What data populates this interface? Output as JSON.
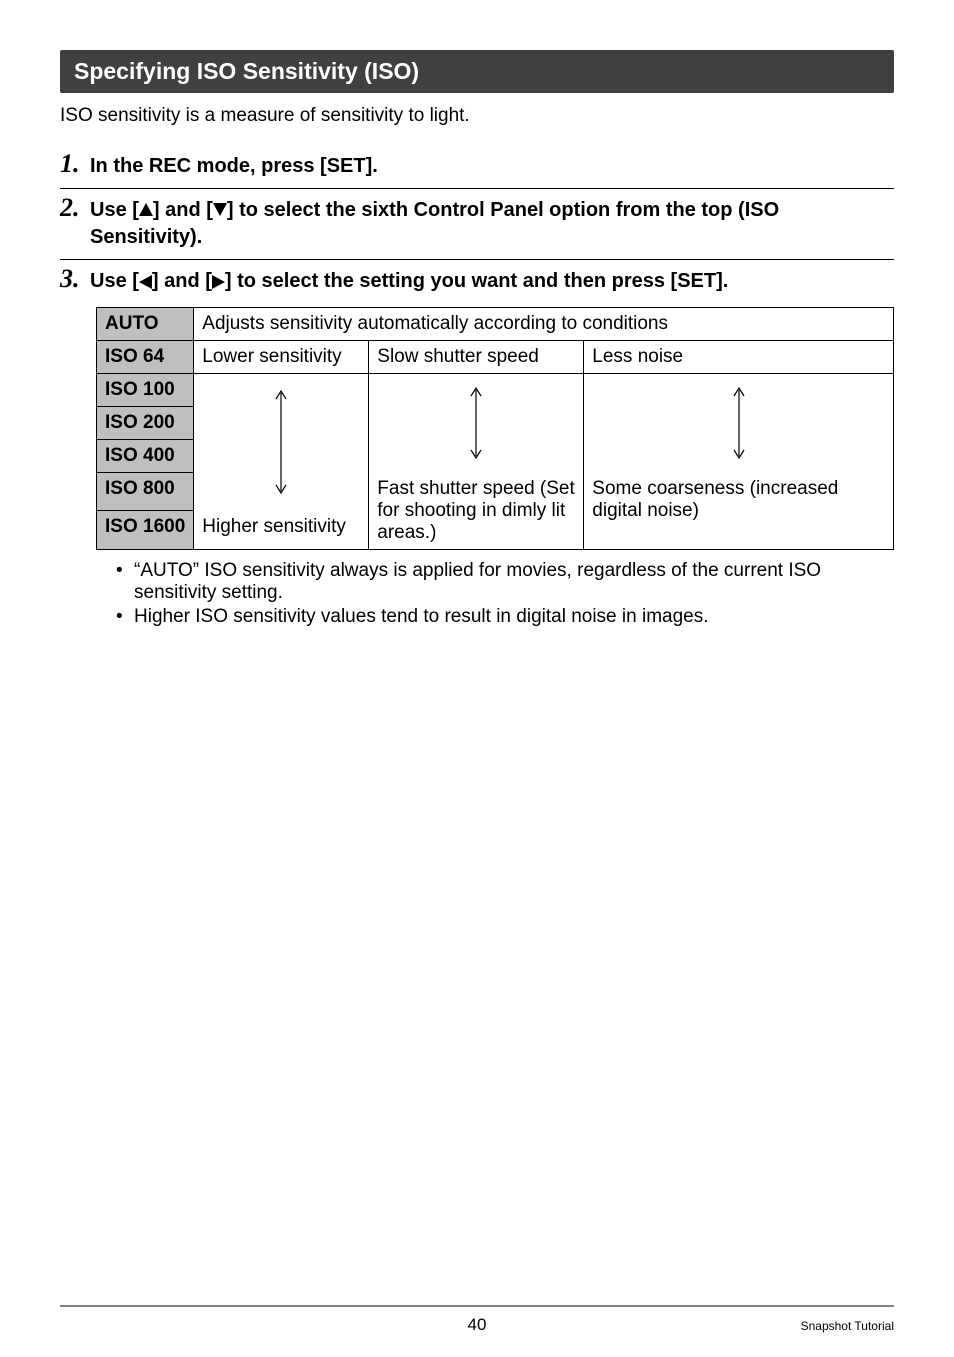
{
  "section_title": "Specifying ISO Sensitivity (ISO)",
  "intro": "ISO sensitivity is a measure of sensitivity to light.",
  "steps": [
    {
      "num": "1.",
      "before": "In the REC mode, press [SET]."
    },
    {
      "num": "2.",
      "before": "Use [",
      "mid": "] and [",
      "after": "] to select the sixth Control Panel option from the top (ISO Sensitivity)."
    },
    {
      "num": "3.",
      "before": "Use [",
      "mid": "] and [",
      "after": "] to select the setting you want and then press [SET]."
    }
  ],
  "table": {
    "rows": [
      "AUTO",
      "ISO 64",
      "ISO 100",
      "ISO 200",
      "ISO 400",
      "ISO 800",
      "ISO 1600"
    ],
    "auto_desc": "Adjusts sensitivity automatically according to conditions",
    "col1_top": "Lower sensitivity",
    "col1_bottom": "Higher sensitivity",
    "col2_top": "Slow shutter speed",
    "col2_bottom": "Fast shutter speed (Set for shooting in dimly lit areas.)",
    "col3_top": "Less noise",
    "col3_bottom": "Some coarseness (increased digital noise)"
  },
  "notes": [
    "“AUTO” ISO sensitivity always is applied for movies, regardless of the current ISO sensitivity setting.",
    "Higher ISO sensitivity values tend to result in digital noise in images."
  ],
  "footer": {
    "page": "40",
    "chapter": "Snapshot Tutorial"
  }
}
